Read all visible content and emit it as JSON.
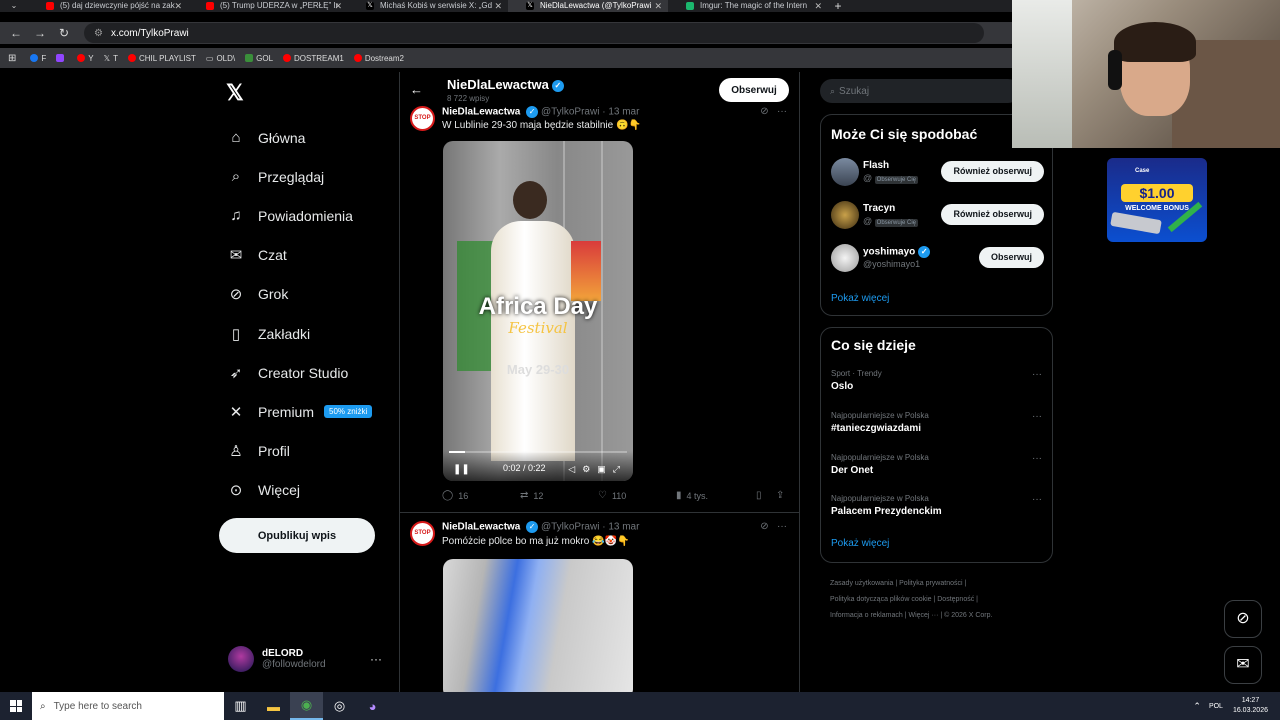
{
  "browser": {
    "tabs": [
      {
        "title": "(5) daj dziewczynie pójść na zak",
        "color": "#ff0000"
      },
      {
        "title": "(5) Trump UDERZA w „PERŁĘ” Ir",
        "color": "#ff0000"
      },
      {
        "title": "Michaś Kobiś w serwisie X: „Gd",
        "color": "#ffffff"
      },
      {
        "title": "NieDlaLewactwa (@TylkoPrawi",
        "color": "#ffffff"
      },
      {
        "title": "Imgur: The magic of the Intern",
        "color": "#1bb76e"
      }
    ],
    "url": "x.com/TylkoPrawi",
    "bookmarks": [
      "F",
      "Y",
      "T",
      "CHIL PLAYLIST",
      "OLD\\",
      "GOL",
      "DOSTREAM1",
      "Dostream2"
    ]
  },
  "nav": {
    "items": [
      {
        "label": "Główna",
        "icon": "home-icon",
        "glyph": "⌂"
      },
      {
        "label": "Przeglądaj",
        "icon": "search-icon",
        "glyph": "⌕"
      },
      {
        "label": "Powiadomienia",
        "icon": "bell-icon",
        "glyph": "♫"
      },
      {
        "label": "Czat",
        "icon": "mail-icon",
        "glyph": "✉"
      },
      {
        "label": "Grok",
        "icon": "grok-icon",
        "glyph": "⊘"
      },
      {
        "label": "Zakładki",
        "icon": "bookmark-icon",
        "glyph": "▯"
      },
      {
        "label": "Creator Studio",
        "icon": "rocket-icon",
        "glyph": "➶"
      },
      {
        "label": "Premium",
        "icon": "x-logo-icon",
        "glyph": "✕",
        "badge": "50% zniżki"
      },
      {
        "label": "Profil",
        "icon": "person-icon",
        "glyph": "♙"
      },
      {
        "label": "Więcej",
        "icon": "more-circle-icon",
        "glyph": "⊙"
      }
    ],
    "publish": "Opublikuj wpis",
    "account": {
      "name": "dELORD",
      "handle": "@followdelord"
    }
  },
  "profile_header": {
    "name": "NieDlaLewactwa",
    "posts": "8 722 wpisy",
    "follow": "Obserwuj"
  },
  "tweets": [
    {
      "name": "NieDlaLewactwa",
      "handle": "@TylkoPrawi",
      "date": "· 13 mar",
      "text": "W Lublinie 29-30 maja będzie stabilnie 🙃👇",
      "video": {
        "title": "Africa Day",
        "subtitle": "Festival",
        "date": "May 29-30",
        "time": "0:02 / 0:22",
        "progress": 0.09
      },
      "replies": "16",
      "reposts": "12",
      "likes": "110",
      "views": "4 tys."
    },
    {
      "name": "NieDlaLewactwa",
      "handle": "@TylkoPrawi",
      "date": "· 13 mar",
      "text": "Pomóżcie p0lce bo ma już mokro 😂🤡👇"
    }
  ],
  "right": {
    "search_placeholder": "Szukaj",
    "who_to_follow": {
      "title": "Może Ci się spodobać",
      "users": [
        {
          "name": "Flash",
          "handle": "@",
          "tag": "Obserwuje Cię",
          "button": "Również obserwuj"
        },
        {
          "name": "Tracyn",
          "handle": "@",
          "tag": "Obserwuje Cię",
          "button": "Również obserwuj"
        },
        {
          "name": "yoshimayo",
          "handle": "@yoshimayo1",
          "tag": "",
          "button": "Obserwuj"
        }
      ],
      "more": "Pokaż więcej"
    },
    "trends": {
      "title": "Co się dzieje",
      "items": [
        {
          "category": "Sport · Trendy",
          "name": "Oslo"
        },
        {
          "category": "Najpopularniejsze w Polska",
          "name": "#tanieczgwiazdami"
        },
        {
          "category": "Najpopularniejsze w Polska",
          "name": "Der Onet"
        },
        {
          "category": "Najpopularniejsze w Polska",
          "name": "Palacem Prezydenckim"
        }
      ],
      "more": "Pokaż więcej"
    },
    "footer": {
      "l1": "Zasady użytkowania | Polityka prywatności |",
      "l2": "Polityka dotycząca plików cookie | Dostępność |",
      "l3": "Informacja o reklamach | Więcej ··· | © 2026 X Corp."
    }
  },
  "ad": {
    "brand": "Case",
    "amount": "$1.00",
    "text": "WELCOME BONUS"
  },
  "taskbar": {
    "search": "Type here to search",
    "lang": "POL",
    "time": "14:27",
    "date": "16.03.2026"
  },
  "colors": {
    "accent": "#1d9bf0",
    "bg": "#000000",
    "border": "#2f3336"
  }
}
